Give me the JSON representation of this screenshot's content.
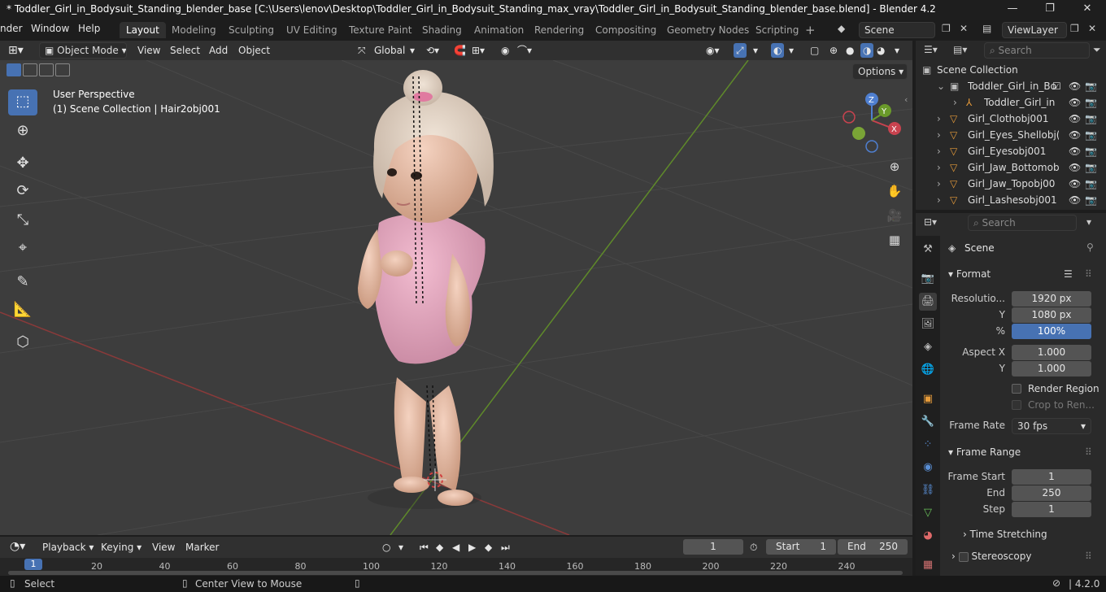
{
  "titlebar": {
    "title": "* Toddler_Girl_in_Bodysuit_Standing_blender_base [C:\\Users\\lenov\\Desktop\\Toddler_Girl_in_Bodysuit_Standing_max_vray\\Toddler_Girl_in_Bodysuit_Standing_blender_base.blend] - Blender 4.2",
    "minimize": "—",
    "maximize": "❐",
    "close": "✕"
  },
  "menus": [
    "nder",
    "Window",
    "Help"
  ],
  "workspaces": [
    "Layout",
    "Modeling",
    "Sculpting",
    "UV Editing",
    "Texture Paint",
    "Shading",
    "Animation",
    "Rendering",
    "Compositing",
    "Geometry Nodes",
    "Scripting"
  ],
  "add_workspace": "+",
  "scene_field": "Scene",
  "viewlayer_field": "ViewLayer",
  "vp_header": {
    "mode": "Object Mode",
    "view": "View",
    "select": "Select",
    "add": "Add",
    "object": "Object",
    "orientation": "Global",
    "options": "Options"
  },
  "viewport": {
    "perspective": "User Perspective",
    "collection_info": "(1) Scene Collection | Hair2obj001",
    "gizmo_axes": [
      "Z",
      "Y",
      "X"
    ]
  },
  "outliner": {
    "search_placeholder": "Search",
    "root": "Scene Collection",
    "rows": [
      {
        "label": "Toddler_Girl_in_Bo",
        "indent": 1
      },
      {
        "label": "Toddler_Girl_in",
        "indent": 2
      },
      {
        "label": "Girl_Clothobj001",
        "indent": 1
      },
      {
        "label": "Girl_Eyes_Shellobj(",
        "indent": 1
      },
      {
        "label": "Girl_Eyesobj001",
        "indent": 1
      },
      {
        "label": "Girl_Jaw_Bottomob",
        "indent": 1
      },
      {
        "label": "Girl_Jaw_Topobj00",
        "indent": 1
      },
      {
        "label": "Girl_Lashesobj001",
        "indent": 1
      }
    ]
  },
  "properties": {
    "search_placeholder": "Search",
    "context": "Scene",
    "format_panel": "Format",
    "resolution_label": "Resolutio...",
    "res_x": "1920 px",
    "y_label": "Y",
    "res_y": "1080 px",
    "pct_label": "%",
    "pct": "100%",
    "aspect_label": "Aspect X",
    "aspect_x": "1.000",
    "aspect_y_label": "Y",
    "aspect_y": "1.000",
    "render_region": "Render Region",
    "crop": "Crop to Ren...",
    "frame_rate_label": "Frame Rate",
    "frame_rate": "30 fps",
    "frame_range_panel": "Frame Range",
    "frame_start_label": "Frame Start",
    "frame_start": "1",
    "end_label": "End",
    "end": "250",
    "step_label": "Step",
    "step": "1",
    "time_stretching": "Time Stretching",
    "stereoscopy": "Stereoscopy"
  },
  "timeline": {
    "playback": "Playback",
    "keying": "Keying",
    "view": "View",
    "marker": "Marker",
    "current_frame": "1",
    "start_label": "Start",
    "start": "1",
    "end_label": "End",
    "end": "250",
    "ticks": [
      "1",
      "20",
      "40",
      "60",
      "80",
      "100",
      "120",
      "140",
      "160",
      "180",
      "200",
      "220",
      "240"
    ]
  },
  "statusbar": {
    "select": "Select",
    "center_view": "Center View to Mouse",
    "version": "4.2.0"
  },
  "colors": {
    "accent": "#4772b3",
    "x_axis": "#c8434f",
    "y_axis": "#6a9a2a",
    "bodysuit": "#e8a7bf"
  }
}
